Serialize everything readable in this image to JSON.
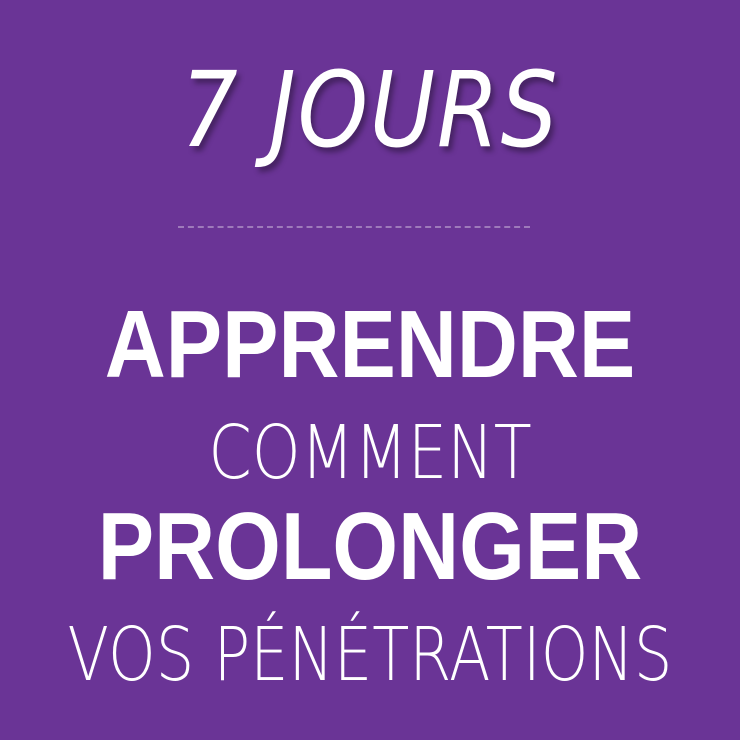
{
  "title": "7 JOURS",
  "lines": [
    {
      "text": "APPRENDRE",
      "weight": "bold"
    },
    {
      "text": "COMMENT",
      "weight": "light"
    },
    {
      "text": "PROLONGER",
      "weight": "bold"
    },
    {
      "text": "VOS PÉNÉTRATIONS",
      "weight": "light"
    }
  ],
  "colors": {
    "background": "#6a3496",
    "text": "#ffffff"
  }
}
